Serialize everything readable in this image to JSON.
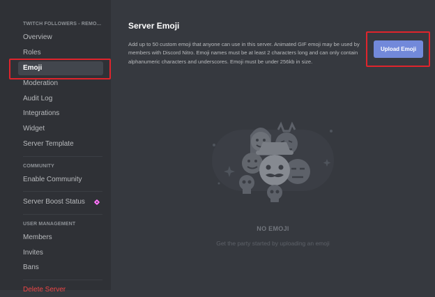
{
  "sidebar": {
    "server_header": "TWITCH FOLLOWERS - REMO...",
    "items": [
      {
        "label": "Overview"
      },
      {
        "label": "Roles"
      },
      {
        "label": "Emoji"
      },
      {
        "label": "Moderation"
      },
      {
        "label": "Audit Log"
      },
      {
        "label": "Integrations"
      },
      {
        "label": "Widget"
      },
      {
        "label": "Server Template"
      }
    ],
    "community_header": "COMMUNITY",
    "community_items": [
      {
        "label": "Enable Community"
      }
    ],
    "boost": {
      "label": "Server Boost Status",
      "icon": "boost-gem-icon",
      "icon_color": "#ff73fa"
    },
    "user_management_header": "USER MANAGEMENT",
    "user_items": [
      {
        "label": "Members"
      },
      {
        "label": "Invites"
      },
      {
        "label": "Bans"
      }
    ],
    "danger_item": {
      "label": "Delete Server"
    },
    "active_item": "Emoji"
  },
  "main": {
    "title": "Server Emoji",
    "description": "Add up to 50 custom emoji that anyone can use in this server. Animated GIF emoji may be used by members with Discord Nitro. Emoji names must be at least 2 characters long and can only contain alphanumeric characters and underscores. Emoji must be under 256kb in size.",
    "upload_button": "Upload Emoji",
    "empty_title": "NO EMOJI",
    "empty_subtitle": "Get the party started by uploading an emoji"
  },
  "colors": {
    "sidebar_bg": "#2f3136",
    "main_bg": "#36393f",
    "accent": "#7289da",
    "highlight_box": "#e0242c"
  }
}
